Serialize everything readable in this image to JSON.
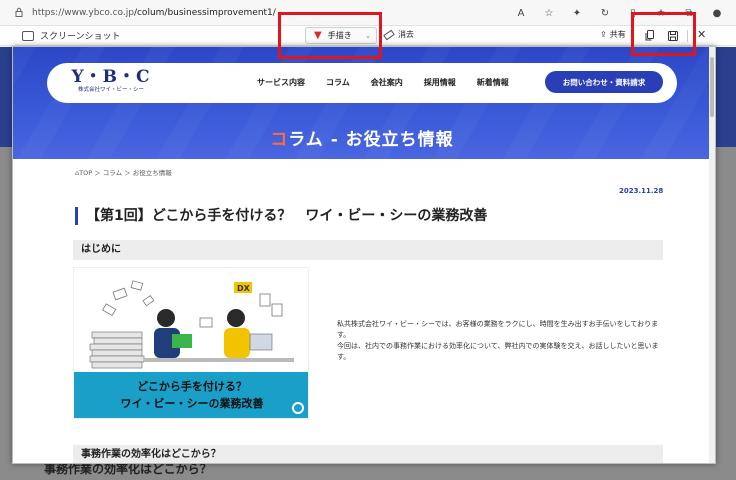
{
  "browser": {
    "url_prefix": "https://www.ybco.co.jp",
    "url_path": "/colum/businessimprovement1/"
  },
  "screenshot_toolbar": {
    "title": "スクリーンショット",
    "draw_label": "手描き",
    "erase_label": "消去",
    "share_label": "共有"
  },
  "site": {
    "logo": "Y・B・C",
    "logo_sub": "株式会社ワイ・ビー・シー",
    "nav": [
      "サービス内容",
      "コラム",
      "会社案内",
      "採用情報",
      "新着情報"
    ],
    "contact_button": "お問い合わせ・資料請求",
    "hero_title_accent": "コ",
    "hero_title_rest": "ラム - お役立ち情報"
  },
  "article": {
    "breadcrumb": "TOP ＞ コラム ＞ お役立ち情報",
    "date": "2023.11.28",
    "title": "【第1回】どこから手を付ける？　ワイ・ビー・シーの業務改善",
    "section1": "はじめに",
    "image_line1": "どこから手を付ける？",
    "image_line2": "ワイ・ビー・シーの業務改善",
    "image_badge": "DX",
    "intro_line1": "私共株式会社ワイ・ビー・シーでは、お客様の業務をラクにし、時間を生み出すお手伝いをしております。",
    "intro_line2": "今回は、社内での事務作業における効率化について、弊社内での実体験を交え、お話ししたいと思います。",
    "section2": "事務作業の効率化はどこから？"
  },
  "background": {
    "visible_text": "事務作業の効率化はどこから？"
  },
  "colors": {
    "brand_blue": "#2a3fb5",
    "accent_orange": "#ff6a3d",
    "annotation_red": "#e1151c"
  }
}
